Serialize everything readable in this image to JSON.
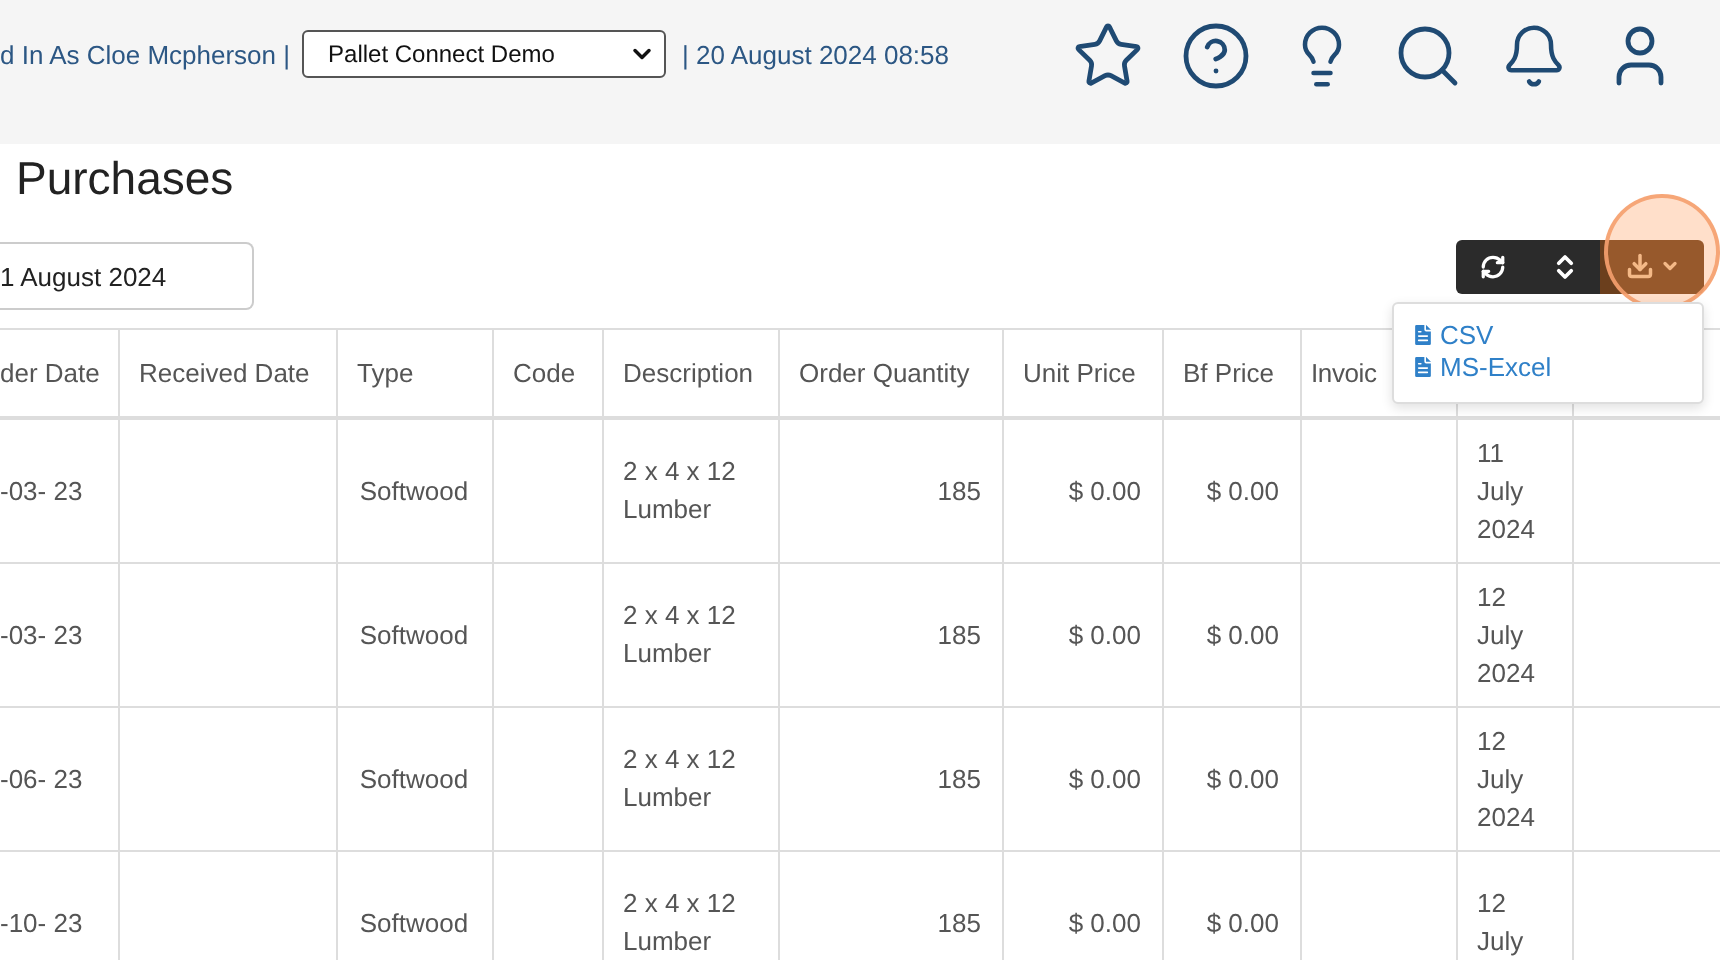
{
  "header": {
    "user_text": "d In As Cloe Mcpherson |",
    "company_select": {
      "value": "Pallet Connect Demo"
    },
    "datetime": "| 20 August 2024 08:58"
  },
  "title": "Purchases",
  "date_field": {
    "value": "1 August 2024"
  },
  "export_menu": {
    "items": [
      {
        "label": "CSV"
      },
      {
        "label": "MS-Excel"
      }
    ]
  },
  "table": {
    "columns": [
      "der Date",
      "Received Date",
      "Type",
      "Code",
      "Description",
      "Order Quantity",
      "Unit Price",
      "Bf Price",
      "Invoic"
    ],
    "rows": [
      {
        "order_date": "-03- 23",
        "type": "Softwood",
        "description": "2 x 4 x 12 Lumber",
        "order_quantity": "185",
        "unit_price": "$ 0.00",
        "bf_price": "$ 0.00",
        "column_10": "11 July 2024"
      },
      {
        "order_date": "-03- 23",
        "type": "Softwood",
        "description": "2 x 4 x 12 Lumber",
        "order_quantity": "185",
        "unit_price": "$ 0.00",
        "bf_price": "$ 0.00",
        "column_10": "12 July 2024"
      },
      {
        "order_date": "-06- 23",
        "type": "Softwood",
        "description": "2 x 4 x 12 Lumber",
        "order_quantity": "185",
        "unit_price": "$ 0.00",
        "bf_price": "$ 0.00",
        "column_10": "12 July 2024"
      },
      {
        "order_date": "-10- 23",
        "type": "Softwood",
        "description": "2 x 4 x 12 Lumber",
        "order_quantity": "185",
        "unit_price": "$ 0.00",
        "bf_price": "$ 0.00",
        "column_10": "12 July"
      }
    ]
  }
}
